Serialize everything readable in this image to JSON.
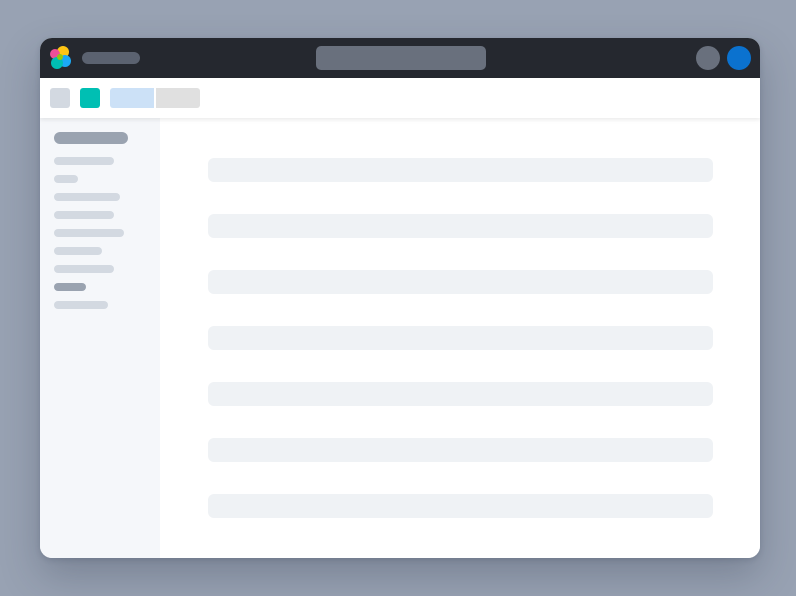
{
  "window": {
    "chrome_color": "#25282f",
    "accent_color": "#0b72cf",
    "space_color": "#00bfb3"
  },
  "header": {
    "logo_icon": "elastic-logo-icon",
    "app_title": "",
    "search_placeholder": "",
    "help_icon": "help-icon",
    "user_icon": "user-avatar"
  },
  "toolbar": {
    "menu_icon": "menu-icon",
    "space_icon": "space-icon",
    "breadcrumbs": [
      "",
      ""
    ]
  },
  "sidebar": {
    "heading": "",
    "items": [
      {
        "label": "",
        "active": false
      },
      {
        "label": "",
        "active": false
      },
      {
        "label": "",
        "active": false
      },
      {
        "label": "",
        "active": false
      },
      {
        "label": "",
        "active": false
      },
      {
        "label": "",
        "active": false
      },
      {
        "label": "",
        "active": false
      },
      {
        "label": "",
        "active": true
      },
      {
        "label": "",
        "active": false
      }
    ]
  },
  "main": {
    "rows": [
      "",
      "",
      "",
      "",
      "",
      "",
      ""
    ]
  }
}
